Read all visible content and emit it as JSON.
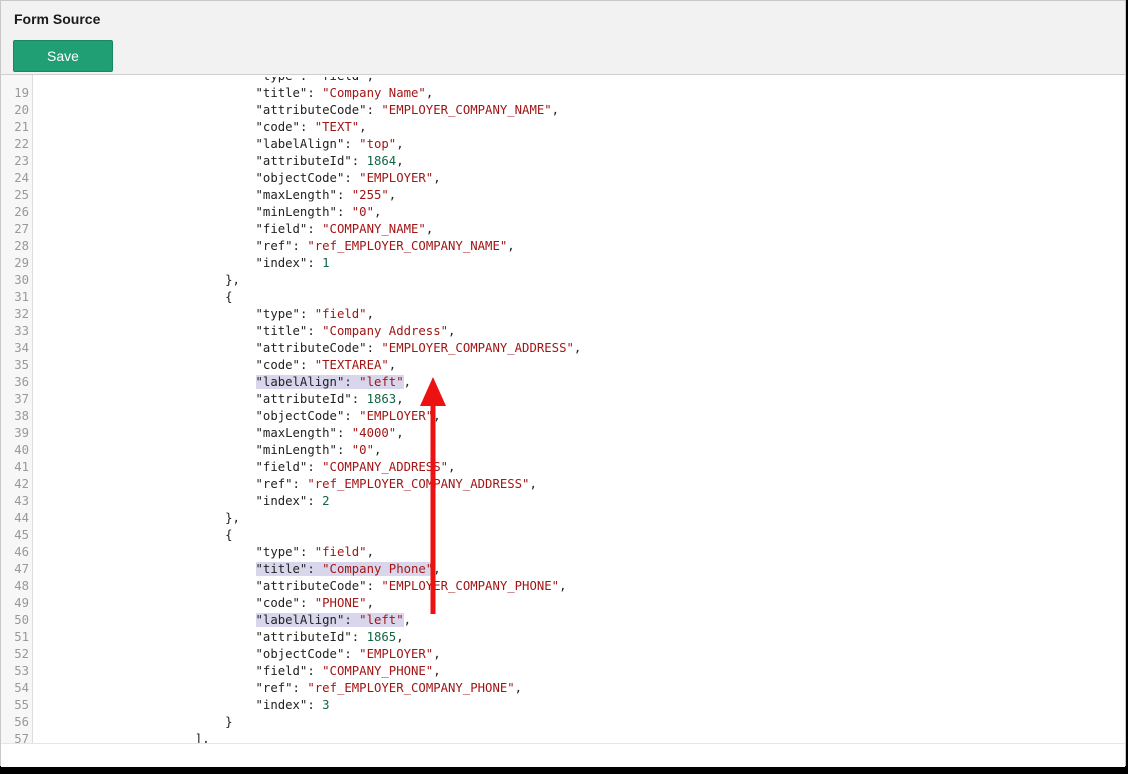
{
  "header": {
    "title": "Form Source",
    "save_label": "Save"
  },
  "editor": {
    "top_partial": "\"type\": \"field\",",
    "bottom_partial": "\"index\": 1",
    "lines": [
      {
        "n": "19",
        "indent": 28,
        "tokens": [
          [
            "k",
            "\"title\""
          ],
          [
            "p",
            ": "
          ],
          [
            "s",
            "\"Company Name\""
          ],
          [
            "p",
            ","
          ]
        ]
      },
      {
        "n": "20",
        "indent": 28,
        "tokens": [
          [
            "k",
            "\"attributeCode\""
          ],
          [
            "p",
            ": "
          ],
          [
            "s",
            "\"EMPLOYER_COMPANY_NAME\""
          ],
          [
            "p",
            ","
          ]
        ]
      },
      {
        "n": "21",
        "indent": 28,
        "tokens": [
          [
            "k",
            "\"code\""
          ],
          [
            "p",
            ": "
          ],
          [
            "s",
            "\"TEXT\""
          ],
          [
            "p",
            ","
          ]
        ]
      },
      {
        "n": "22",
        "indent": 28,
        "tokens": [
          [
            "k",
            "\"labelAlign\""
          ],
          [
            "p",
            ": "
          ],
          [
            "s",
            "\"top\""
          ],
          [
            "p",
            ","
          ]
        ]
      },
      {
        "n": "23",
        "indent": 28,
        "tokens": [
          [
            "k",
            "\"attributeId\""
          ],
          [
            "p",
            ": "
          ],
          [
            "n",
            "1864"
          ],
          [
            "p",
            ","
          ]
        ]
      },
      {
        "n": "24",
        "indent": 28,
        "tokens": [
          [
            "k",
            "\"objectCode\""
          ],
          [
            "p",
            ": "
          ],
          [
            "s",
            "\"EMPLOYER\""
          ],
          [
            "p",
            ","
          ]
        ]
      },
      {
        "n": "25",
        "indent": 28,
        "tokens": [
          [
            "k",
            "\"maxLength\""
          ],
          [
            "p",
            ": "
          ],
          [
            "s",
            "\"255\""
          ],
          [
            "p",
            ","
          ]
        ]
      },
      {
        "n": "26",
        "indent": 28,
        "tokens": [
          [
            "k",
            "\"minLength\""
          ],
          [
            "p",
            ": "
          ],
          [
            "s",
            "\"0\""
          ],
          [
            "p",
            ","
          ]
        ]
      },
      {
        "n": "27",
        "indent": 28,
        "tokens": [
          [
            "k",
            "\"field\""
          ],
          [
            "p",
            ": "
          ],
          [
            "s",
            "\"COMPANY_NAME\""
          ],
          [
            "p",
            ","
          ]
        ]
      },
      {
        "n": "28",
        "indent": 28,
        "tokens": [
          [
            "k",
            "\"ref\""
          ],
          [
            "p",
            ": "
          ],
          [
            "s",
            "\"ref_EMPLOYER_COMPANY_NAME\""
          ],
          [
            "p",
            ","
          ]
        ]
      },
      {
        "n": "29",
        "indent": 28,
        "tokens": [
          [
            "k",
            "\"index\""
          ],
          [
            "p",
            ": "
          ],
          [
            "n",
            "1"
          ]
        ]
      },
      {
        "n": "30",
        "indent": 24,
        "tokens": [
          [
            "p",
            "},"
          ]
        ]
      },
      {
        "n": "31",
        "indent": 24,
        "tokens": [
          [
            "p",
            "{"
          ]
        ]
      },
      {
        "n": "32",
        "indent": 28,
        "tokens": [
          [
            "k",
            "\"type\""
          ],
          [
            "p",
            ": "
          ],
          [
            "s",
            "\"field\""
          ],
          [
            "p",
            ","
          ]
        ]
      },
      {
        "n": "33",
        "indent": 28,
        "tokens": [
          [
            "k",
            "\"title\""
          ],
          [
            "p",
            ": "
          ],
          [
            "s",
            "\"Company Address\""
          ],
          [
            "p",
            ","
          ]
        ]
      },
      {
        "n": "34",
        "indent": 28,
        "tokens": [
          [
            "k",
            "\"attributeCode\""
          ],
          [
            "p",
            ": "
          ],
          [
            "s",
            "\"EMPLOYER_COMPANY_ADDRESS\""
          ],
          [
            "p",
            ","
          ]
        ]
      },
      {
        "n": "35",
        "indent": 28,
        "tokens": [
          [
            "k",
            "\"code\""
          ],
          [
            "p",
            ": "
          ],
          [
            "s",
            "\"TEXTAREA\""
          ],
          [
            "p",
            ","
          ]
        ]
      },
      {
        "n": "36",
        "indent": 28,
        "hl": true,
        "tokens": [
          [
            "k",
            "\"labelAlign\""
          ],
          [
            "p",
            ": "
          ],
          [
            "s",
            "\"left\""
          ],
          [
            "p",
            ","
          ]
        ]
      },
      {
        "n": "37",
        "indent": 28,
        "tokens": [
          [
            "k",
            "\"attributeId\""
          ],
          [
            "p",
            ": "
          ],
          [
            "n",
            "1863"
          ],
          [
            "p",
            ","
          ]
        ]
      },
      {
        "n": "38",
        "indent": 28,
        "tokens": [
          [
            "k",
            "\"objectCode\""
          ],
          [
            "p",
            ": "
          ],
          [
            "s",
            "\"EMPLOYER\""
          ],
          [
            "p",
            ","
          ]
        ]
      },
      {
        "n": "39",
        "indent": 28,
        "tokens": [
          [
            "k",
            "\"maxLength\""
          ],
          [
            "p",
            ": "
          ],
          [
            "s",
            "\"4000\""
          ],
          [
            "p",
            ","
          ]
        ]
      },
      {
        "n": "40",
        "indent": 28,
        "tokens": [
          [
            "k",
            "\"minLength\""
          ],
          [
            "p",
            ": "
          ],
          [
            "s",
            "\"0\""
          ],
          [
            "p",
            ","
          ]
        ]
      },
      {
        "n": "41",
        "indent": 28,
        "tokens": [
          [
            "k",
            "\"field\""
          ],
          [
            "p",
            ": "
          ],
          [
            "s",
            "\"COMPANY_ADDRESS\""
          ],
          [
            "p",
            ","
          ]
        ]
      },
      {
        "n": "42",
        "indent": 28,
        "tokens": [
          [
            "k",
            "\"ref\""
          ],
          [
            "p",
            ": "
          ],
          [
            "s",
            "\"ref_EMPLOYER_COMPANY_ADDRESS\""
          ],
          [
            "p",
            ","
          ]
        ]
      },
      {
        "n": "43",
        "indent": 28,
        "tokens": [
          [
            "k",
            "\"index\""
          ],
          [
            "p",
            ": "
          ],
          [
            "n",
            "2"
          ]
        ]
      },
      {
        "n": "44",
        "indent": 24,
        "tokens": [
          [
            "p",
            "},"
          ]
        ]
      },
      {
        "n": "45",
        "indent": 24,
        "tokens": [
          [
            "p",
            "{"
          ]
        ]
      },
      {
        "n": "46",
        "indent": 28,
        "tokens": [
          [
            "k",
            "\"type\""
          ],
          [
            "p",
            ": "
          ],
          [
            "s",
            "\"field\""
          ],
          [
            "p",
            ","
          ]
        ]
      },
      {
        "n": "47",
        "indent": 28,
        "hl": true,
        "tokens": [
          [
            "k",
            "\"title\""
          ],
          [
            "p",
            ": "
          ],
          [
            "s",
            "\"Company Phone\""
          ],
          [
            "p",
            ","
          ]
        ]
      },
      {
        "n": "48",
        "indent": 28,
        "tokens": [
          [
            "k",
            "\"attributeCode\""
          ],
          [
            "p",
            ": "
          ],
          [
            "s",
            "\"EMPLOYER_COMPANY_PHONE\""
          ],
          [
            "p",
            ","
          ]
        ]
      },
      {
        "n": "49",
        "indent": 28,
        "tokens": [
          [
            "k",
            "\"code\""
          ],
          [
            "p",
            ": "
          ],
          [
            "s",
            "\"PHONE\""
          ],
          [
            "p",
            ","
          ]
        ]
      },
      {
        "n": "50",
        "indent": 28,
        "hl": true,
        "tokens": [
          [
            "k",
            "\"labelAlign\""
          ],
          [
            "p",
            ": "
          ],
          [
            "s",
            "\"left\""
          ],
          [
            "p",
            ","
          ]
        ]
      },
      {
        "n": "51",
        "indent": 28,
        "tokens": [
          [
            "k",
            "\"attributeId\""
          ],
          [
            "p",
            ": "
          ],
          [
            "n",
            "1865"
          ],
          [
            "p",
            ","
          ]
        ]
      },
      {
        "n": "52",
        "indent": 28,
        "tokens": [
          [
            "k",
            "\"objectCode\""
          ],
          [
            "p",
            ": "
          ],
          [
            "s",
            "\"EMPLOYER\""
          ],
          [
            "p",
            ","
          ]
        ]
      },
      {
        "n": "53",
        "indent": 28,
        "tokens": [
          [
            "k",
            "\"field\""
          ],
          [
            "p",
            ": "
          ],
          [
            "s",
            "\"COMPANY_PHONE\""
          ],
          [
            "p",
            ","
          ]
        ]
      },
      {
        "n": "54",
        "indent": 28,
        "tokens": [
          [
            "k",
            "\"ref\""
          ],
          [
            "p",
            ": "
          ],
          [
            "s",
            "\"ref_EMPLOYER_COMPANY_PHONE\""
          ],
          [
            "p",
            ","
          ]
        ]
      },
      {
        "n": "55",
        "indent": 28,
        "tokens": [
          [
            "k",
            "\"index\""
          ],
          [
            "p",
            ": "
          ],
          [
            "n",
            "3"
          ]
        ]
      },
      {
        "n": "56",
        "indent": 24,
        "tokens": [
          [
            "p",
            "}"
          ]
        ]
      },
      {
        "n": "57",
        "indent": 20,
        "tokens": [
          [
            "p",
            "],"
          ]
        ]
      }
    ]
  },
  "colors": {
    "save_button": "#1f9f73",
    "string": "#a31515",
    "number": "#116644",
    "highlight": "#d8d6ec",
    "annotation_arrow": "#ee1111"
  }
}
